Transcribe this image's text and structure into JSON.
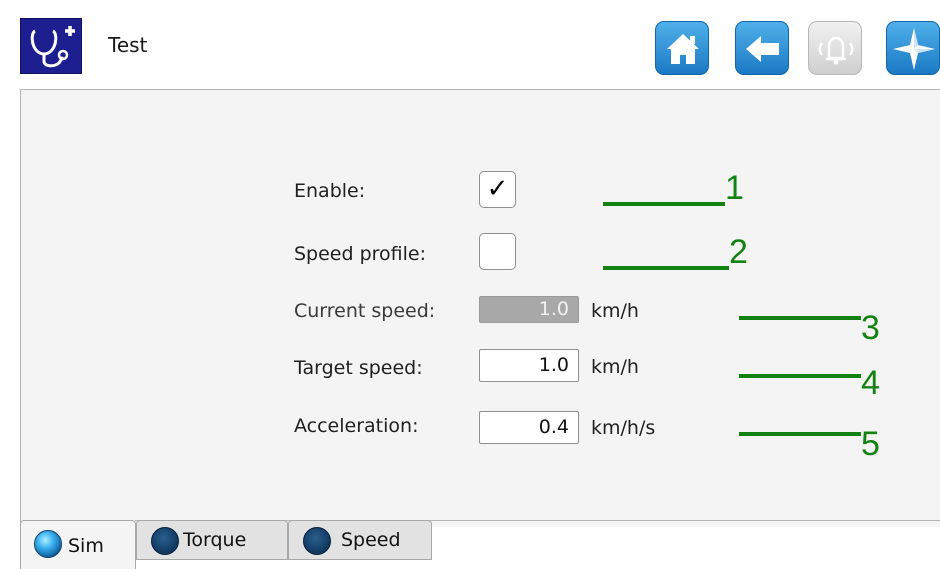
{
  "header": {
    "title": "Test",
    "logo_icon": "stethoscope-plus-icon",
    "toolbar": [
      {
        "name": "home-button",
        "icon": "home-icon",
        "enabled": true
      },
      {
        "name": "back-button",
        "icon": "arrow-left-icon",
        "enabled": true
      },
      {
        "name": "alarm-button",
        "icon": "bell-icon",
        "enabled": false
      },
      {
        "name": "navigate-button",
        "icon": "compass-icon",
        "enabled": true
      }
    ]
  },
  "form": {
    "enable": {
      "label": "Enable:",
      "checked": true,
      "check_glyph": "✓"
    },
    "speed_profile": {
      "label": "Speed profile:",
      "checked": false
    },
    "current_speed": {
      "label": "Current speed:",
      "value": "1.0",
      "unit": "km/h",
      "readonly": true
    },
    "target_speed": {
      "label": "Target speed:",
      "value": "1.0",
      "unit": "km/h"
    },
    "acceleration": {
      "label": "Acceleration:",
      "value": "0.4",
      "unit": "km/h/s"
    }
  },
  "annotations": [
    "1",
    "2",
    "3",
    "4",
    "5"
  ],
  "tabs": [
    {
      "label": "Sim",
      "active": true
    },
    {
      "label": "Torque",
      "active": false
    },
    {
      "label": "Speed",
      "active": false
    }
  ],
  "colors": {
    "annotation": "#128212",
    "toolbar_blue": "#2a8ad6",
    "logo_bg": "#1d1e8f"
  }
}
